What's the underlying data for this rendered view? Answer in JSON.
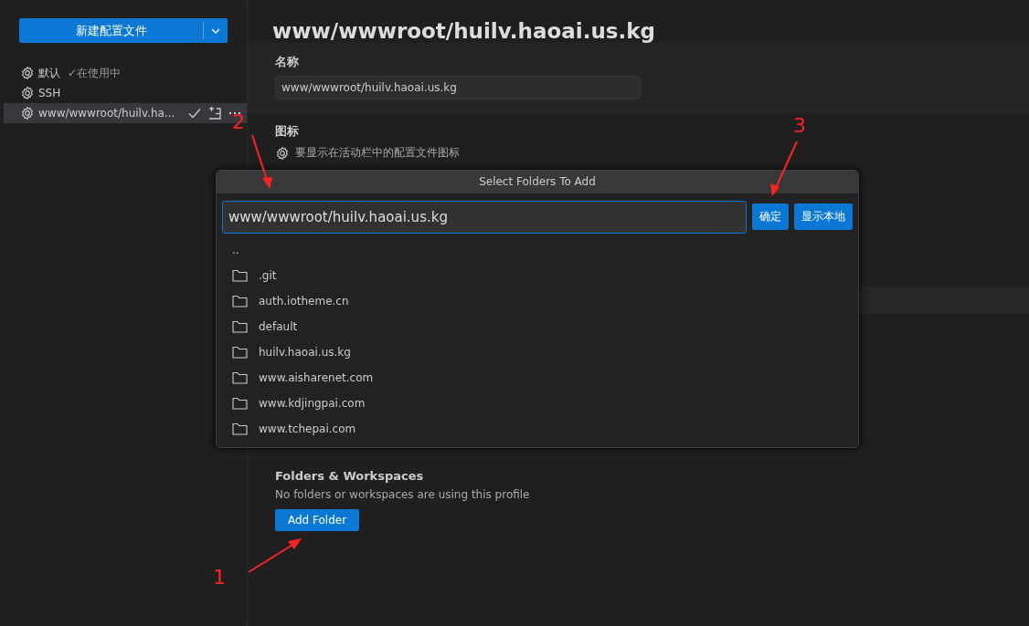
{
  "sidebar": {
    "new_profile_button": {
      "label": "新建配置文件"
    },
    "profiles": [
      {
        "name": "默认",
        "status": "✓在使用中",
        "selected": false,
        "actions": false
      },
      {
        "name": "SSH",
        "selected": false,
        "actions": false
      },
      {
        "name": "www/wwwroot/huilv.ha...",
        "selected": true,
        "actions": true
      }
    ]
  },
  "main": {
    "title": "www/wwwroot/huilv.haoai.us.kg",
    "name_section": {
      "label": "名称",
      "value": "www/wwwroot/huilv.haoai.us.kg"
    },
    "icon_section": {
      "label": "图标",
      "description": "要显示在活动栏中的配置文件图标"
    },
    "folders_section": {
      "label": "Folders & Workspaces",
      "description": "No folders or workspaces are using this profile",
      "button": "Add Folder"
    }
  },
  "dialog": {
    "title": "Select Folders To Add",
    "value": "www/wwwroot/huilv.haoai.us.kg",
    "buttons": [
      "确定",
      "显示本地"
    ],
    "entries": [
      {
        "name": "..",
        "kind": "parent"
      },
      {
        "name": ".git",
        "kind": "folder"
      },
      {
        "name": "auth.iotheme.cn",
        "kind": "folder"
      },
      {
        "name": "default",
        "kind": "folder"
      },
      {
        "name": "huilv.haoai.us.kg",
        "kind": "folder"
      },
      {
        "name": "www.aisharenet.com",
        "kind": "folder"
      },
      {
        "name": "www.kdjingpai.com",
        "kind": "folder"
      },
      {
        "name": "www.tchepai.com",
        "kind": "folder"
      }
    ]
  },
  "annotations": [
    "1",
    "2",
    "3"
  ]
}
